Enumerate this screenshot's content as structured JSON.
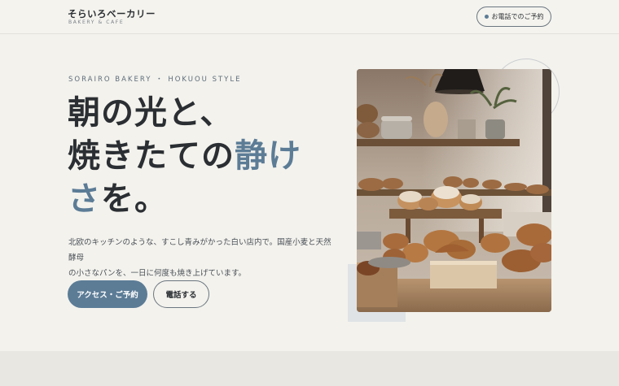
{
  "header": {
    "brand_name": "そらいろベーカリー",
    "brand_sub": "BAKERY & CAFE",
    "call_button": "お電話でのご予約"
  },
  "hero": {
    "eyebrow": "SORAIRO BAKERY ・ HOKUOU STYLE",
    "headline_line1": "朝の光と、",
    "headline_line2_plain": "焼きたての",
    "headline_line2_accent": "静け",
    "headline_line3_accent": "さ",
    "headline_line3_plain": "を。",
    "description_line1": "北欧のキッチンのような、すこし青みがかった白い店内で。国産小麦と天然酵母",
    "description_line2": "の小さなパンを、一日に何度も焼き上げています。",
    "primary_button": "アクセス・ご予約",
    "secondary_button": "電話する"
  },
  "colors": {
    "accent": "#5c7c96",
    "background": "#f3f2ed",
    "text": "#2b2f33"
  },
  "image": {
    "subject": "bakery display shelf with croissants and pastries"
  }
}
